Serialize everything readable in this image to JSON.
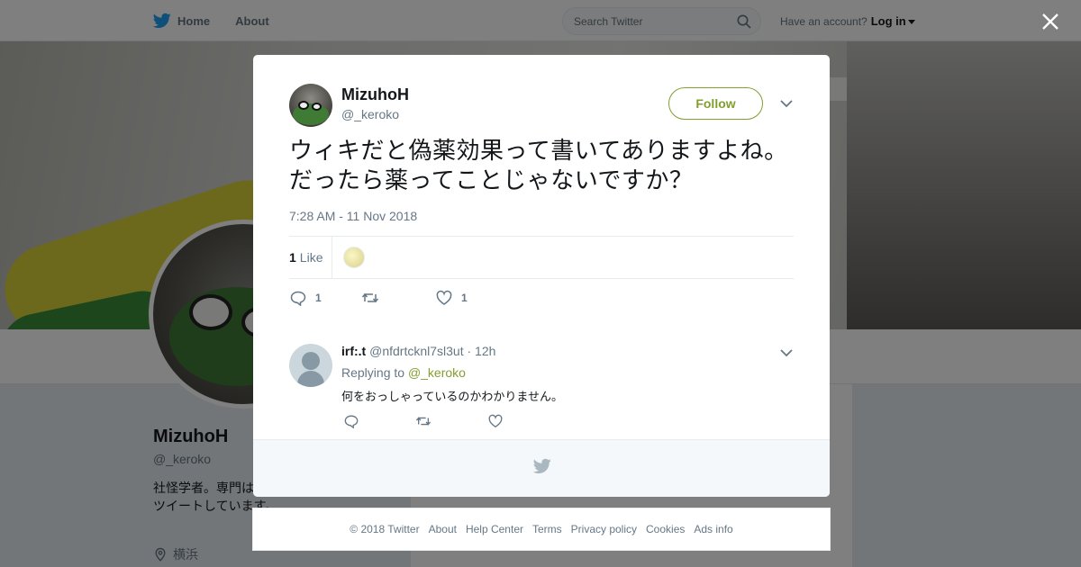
{
  "topbar": {
    "home_label": "Home",
    "about_label": "About",
    "search_placeholder": "Search Twitter",
    "account_prompt": "Have an account?",
    "login_label": "Log in"
  },
  "profile": {
    "name": "MizuhoH",
    "handle": "@_keroko",
    "bio": "社怪学者。専門はジェンダー。だらだらツイートしています。",
    "location": "横浜"
  },
  "tweet": {
    "author_name": "MizuhoH",
    "author_handle": "@_keroko",
    "follow_label": "Follow",
    "text": "ウィキだと偽薬効果って書いてありますよね。だったら薬ってことじゃないですか？",
    "timestamp": "7:28 AM - 11 Nov 2018",
    "like_count": "1",
    "like_word": "Like",
    "reply_count": "1",
    "retweet_count": "",
    "favorite_count": "1"
  },
  "reply": {
    "name": "irf:.t",
    "handle": "@nfdrtcknl7sl3ut",
    "separator": "·",
    "age": "12h",
    "replying_prefix": "Replying to",
    "replying_to": "@_keroko",
    "text": "何をおっしゃっているのかわかりません。"
  },
  "footer": {
    "links": [
      "© 2018 Twitter",
      "About",
      "Help Center",
      "Terms",
      "Privacy policy",
      "Cookies",
      "Ads info"
    ]
  },
  "colors": {
    "accent": "#829e2f",
    "twitter_blue": "#1da1f2",
    "text_secondary": "#657786"
  },
  "icons": {
    "bird": "twitter-bird-icon",
    "search": "search-icon",
    "close": "close-icon",
    "chevron": "chevron-down-icon",
    "reply": "reply-icon",
    "retweet": "retweet-icon",
    "like": "heart-icon",
    "location": "location-pin-icon"
  }
}
